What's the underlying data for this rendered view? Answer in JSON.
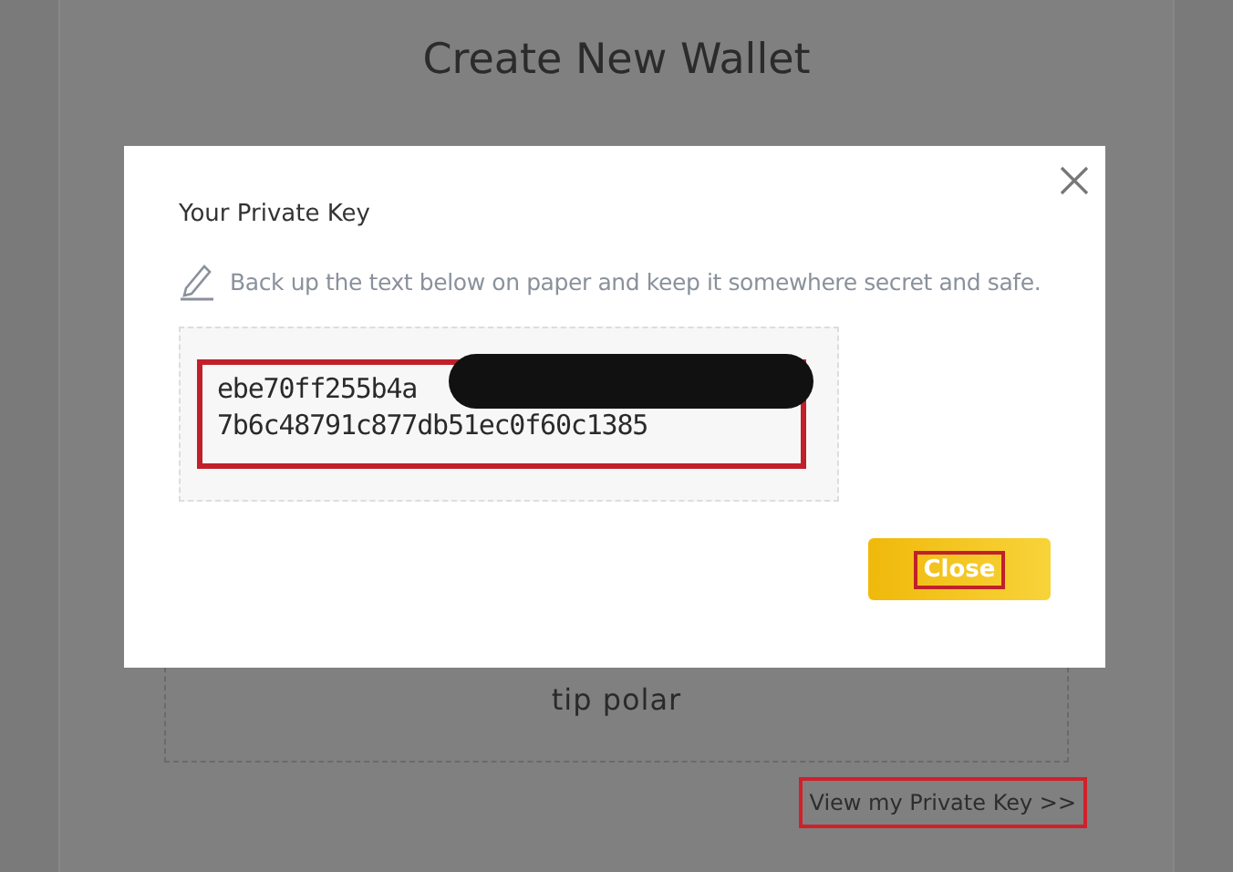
{
  "page": {
    "title": "Create New Wallet",
    "mnemonic_visible": "tip polar",
    "link": "View my Private Key >>"
  },
  "modal": {
    "title": "Your Private Key",
    "instruction": "Back up the text below on paper and keep it somewhere secret and safe.",
    "key_lines": [
      "ebe70ff255b4a",
      "7b6c48791c877db51ec0f60c1385"
    ],
    "button": "Close"
  }
}
